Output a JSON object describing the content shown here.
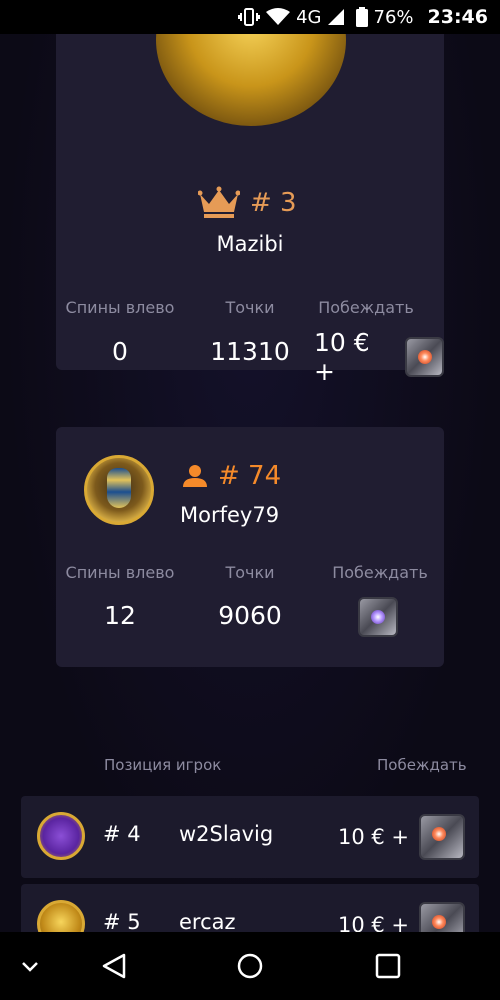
{
  "status_bar": {
    "network": "4G",
    "battery": "76%",
    "time": "23:46"
  },
  "top_card": {
    "rank": "# 3",
    "username": "Mazibi",
    "stats": {
      "spins_label": "Спины влево",
      "points_label": "Точки",
      "win_label": "Побеждать",
      "spins_value": "0",
      "points_value": "11310",
      "win_value": "10 € +"
    }
  },
  "user_card": {
    "rank": "# 74",
    "username": "Morfey79",
    "stats": {
      "spins_label": "Спины влево",
      "points_label": "Точки",
      "win_label": "Побеждать",
      "spins_value": "12",
      "points_value": "9060"
    }
  },
  "leaderboard": {
    "header_left": "Позиция игрок",
    "header_right": "Побеждать",
    "rows": [
      {
        "rank": "# 4",
        "name": "w2Slavig",
        "prize": "10 € +"
      },
      {
        "rank": "# 5",
        "name": "ercaz",
        "prize": "10 € +"
      }
    ]
  },
  "colors": {
    "accent_orange": "#e69b56",
    "card_bg": "#201d31",
    "muted_text": "#8d8ba0"
  }
}
